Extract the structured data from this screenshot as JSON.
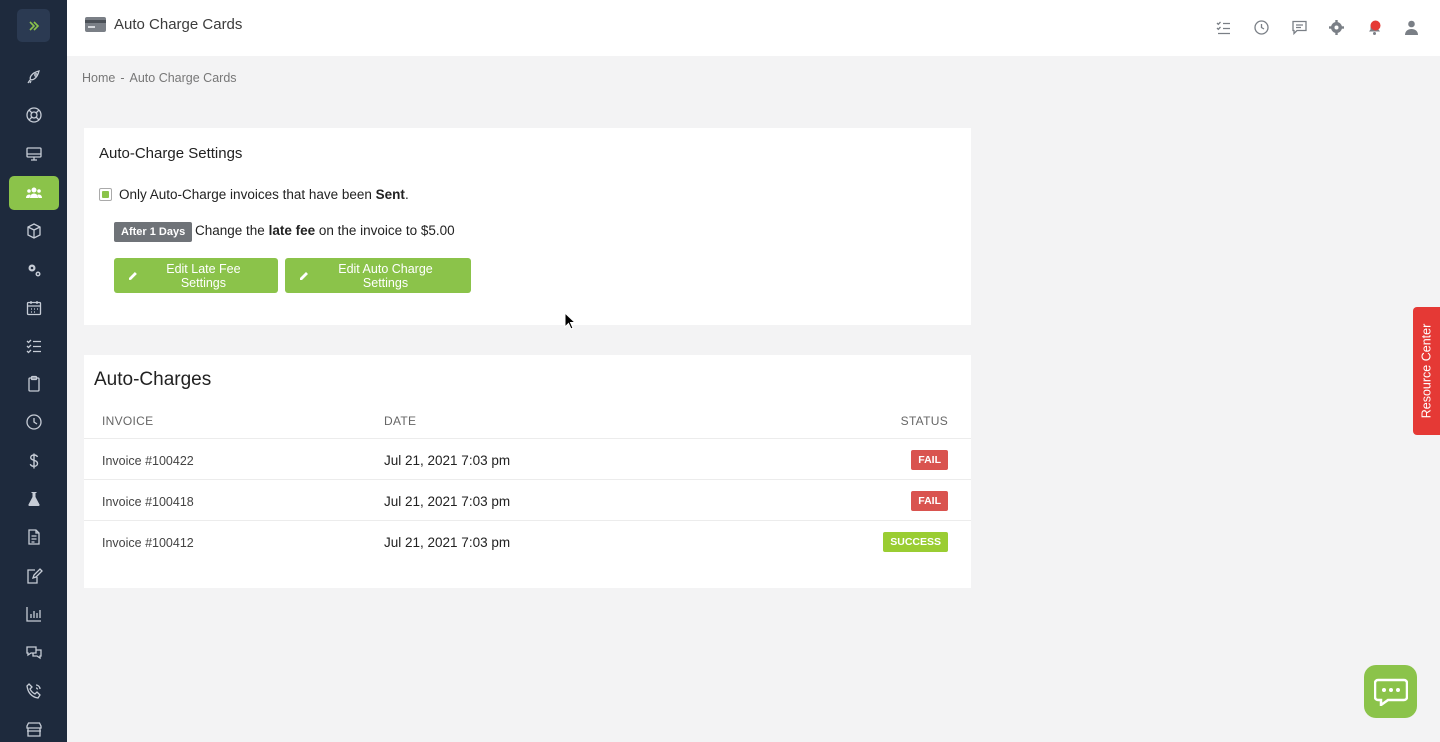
{
  "app": {
    "title": "Auto Charge Cards",
    "accent_color": "#8bc34a",
    "sidebar_color": "#1e2a3d"
  },
  "sidebar": {
    "toggle_icon": "chevron-double-right-icon",
    "items": [
      {
        "icon": "rocket-icon",
        "active": false
      },
      {
        "icon": "support-icon",
        "active": false
      },
      {
        "icon": "monitor-icon",
        "active": false
      },
      {
        "icon": "users-icon",
        "active": true
      },
      {
        "icon": "box-icon",
        "active": false
      },
      {
        "icon": "gears-icon",
        "active": false
      },
      {
        "icon": "calendar-icon",
        "active": false
      },
      {
        "icon": "tasks-icon",
        "active": false
      },
      {
        "icon": "clipboard-icon",
        "active": false
      },
      {
        "icon": "clock-icon",
        "active": false
      },
      {
        "icon": "dollar-icon",
        "active": false
      },
      {
        "icon": "flask-icon",
        "active": false
      },
      {
        "icon": "document-icon",
        "active": false
      },
      {
        "icon": "edit-document-icon",
        "active": false
      },
      {
        "icon": "bar-chart-icon",
        "active": false
      },
      {
        "icon": "chat-bubbles-icon",
        "active": false
      },
      {
        "icon": "phone-icon",
        "active": false
      },
      {
        "icon": "store-icon",
        "active": false
      }
    ]
  },
  "topbar": {
    "title_icon": "credit-card-icon",
    "icons": [
      "tasks-icon",
      "clock-icon",
      "message-icon",
      "gear-icon",
      "notification-bell-icon",
      "user-icon"
    ]
  },
  "breadcrumb": {
    "home": "Home",
    "separator": "-",
    "current": "Auto Charge Cards"
  },
  "settings": {
    "title": "Auto-Charge Settings",
    "sent_prefix": "Only Auto-Charge invoices that have been ",
    "sent_bold": "Sent",
    "sent_suffix": ".",
    "checked": true,
    "days_badge": "After 1 Days",
    "latefee_prefix": "Change the ",
    "latefee_bold": "late fee",
    "latefee_suffix": " on the invoice to $5.00",
    "btn_latefee": "Edit Late Fee Settings",
    "btn_autocharge": "Edit Auto Charge Settings"
  },
  "charges": {
    "title": "Auto-Charges",
    "columns": {
      "invoice": "INVOICE",
      "date": "DATE",
      "status": "STATUS"
    },
    "rows": [
      {
        "invoice": "Invoice #100422",
        "date": "Jul 21, 2021 7:03 pm",
        "status": "FAIL"
      },
      {
        "invoice": "Invoice #100418",
        "date": "Jul 21, 2021 7:03 pm",
        "status": "FAIL"
      },
      {
        "invoice": "Invoice #100412",
        "date": "Jul 21, 2021 7:03 pm",
        "status": "SUCCESS"
      }
    ]
  },
  "resource_center": "Resource Center",
  "chat_icon": "chat-icon"
}
